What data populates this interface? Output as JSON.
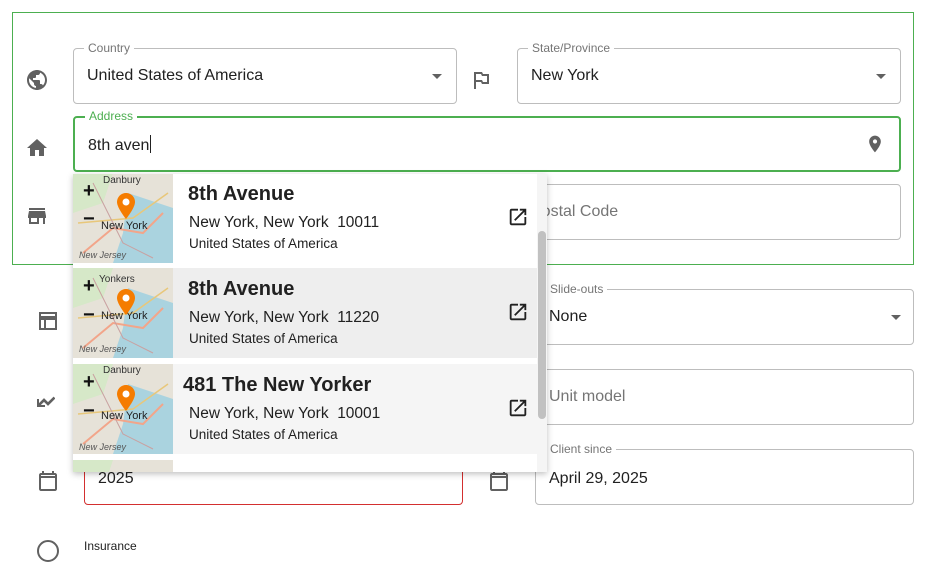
{
  "address_section": {
    "country": {
      "label": "Country",
      "value": "United States of America"
    },
    "state": {
      "label": "State/Province",
      "value": "New York"
    },
    "address": {
      "label": "Address",
      "value": "8th aven"
    },
    "postal": {
      "placeholder": "Postal Code"
    }
  },
  "suggestions": [
    {
      "title": "8th Avenue",
      "line1": "New York, New York  10011",
      "line2": "United States of America",
      "map": {
        "top_town": "Danbury",
        "mid_town": "New York",
        "bottom_town": "New Jersey",
        "zoom_in": "+",
        "zoom_out": "−"
      }
    },
    {
      "title": "8th Avenue",
      "line1": "New York, New York  11220",
      "line2": "United States of America",
      "map": {
        "top_town": "Yonkers",
        "mid_town": "New York",
        "bottom_town": "New Jersey",
        "zoom_in": "+",
        "zoom_out": "−"
      }
    },
    {
      "title": "481 The New Yorker",
      "line1": "New York, New York  10001",
      "line2": "United States of America",
      "map": {
        "top_town": "Danbury",
        "mid_town": "New York",
        "bottom_town": "New Jersey",
        "zoom_in": "+",
        "zoom_out": "−"
      }
    }
  ],
  "lower_section": {
    "slide_outs": {
      "label": "Slide-outs",
      "value": "None"
    },
    "unit_model": {
      "placeholder": "Unit model"
    },
    "year": {
      "value": "2025"
    },
    "client_since": {
      "label": "Client since",
      "value": "April 29, 2025"
    },
    "insurance": {
      "label": "Insurance"
    }
  },
  "colors": {
    "accent": "#4caf50",
    "error": "#d32f2f",
    "pin": "#f57c00"
  },
  "icons": [
    "globe-icon",
    "flag-icon",
    "home-icon",
    "store-icon",
    "location-pin-icon",
    "table-icon",
    "trend-icon",
    "calendar-icon",
    "external-link-icon"
  ]
}
